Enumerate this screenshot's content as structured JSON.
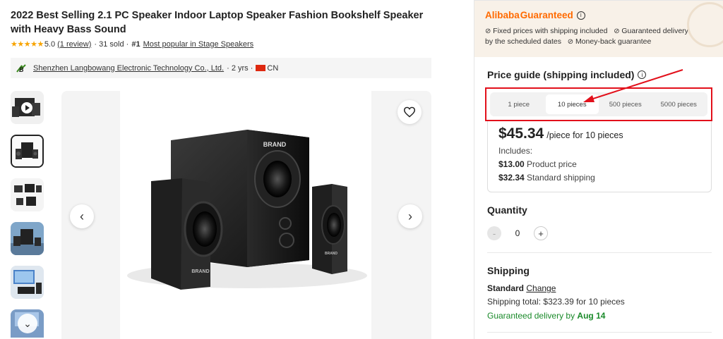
{
  "product": {
    "title": "2022 Best Selling 2.1 PC Speaker Indoor Laptop Speaker Fashion Bookshelf Speaker with Heavy Bass Sound",
    "stars": "★★★★★",
    "rating": "5.0",
    "reviews": "(1 review)",
    "sold": "· 31 sold ·",
    "rank": "#1",
    "rank_text": "Most popular in Stage Speakers"
  },
  "supplier": {
    "name": "Shenzhen Langbowang Electronic Technology Co., Ltd.",
    "years": "· 2 yrs ·",
    "country": "CN",
    "flag_color": "#de2910"
  },
  "gallery": {
    "thumbnails": [
      {
        "kind": "video",
        "icon": "play-icon"
      },
      {
        "kind": "image",
        "selected": true
      },
      {
        "kind": "image"
      },
      {
        "kind": "image"
      },
      {
        "kind": "image"
      },
      {
        "kind": "image",
        "icon": "chevron-down-icon"
      }
    ],
    "image_brand_text": "BRAND",
    "prev_icon": "‹",
    "next_icon": "›",
    "scroll_down_icon": "⌄"
  },
  "guarantee": {
    "brand": "Alibaba",
    "word": "Guaranteed",
    "info_icon": "i",
    "items": [
      "Fixed prices with shipping included",
      "Guaranteed delivery"
    ],
    "items_line2": [
      "by the scheduled dates",
      "Money-back guarantee"
    ]
  },
  "price_guide": {
    "title": "Price guide (shipping included)",
    "info_icon": "i",
    "tabs": [
      "1 piece",
      "10 pieces",
      "500 pieces",
      "5000 pieces"
    ],
    "active_tab": "10 pieces",
    "price": "$45.34",
    "price_unit": "/piece for 10 pieces",
    "includes_label": "Includes:",
    "product_price_value": "$13.00",
    "product_price_label": "Product price",
    "shipping_value": "$32.34",
    "shipping_label": "Standard shipping"
  },
  "quantity": {
    "title": "Quantity",
    "minus": "-",
    "value": "0",
    "plus": "+"
  },
  "shipping": {
    "title": "Shipping",
    "method": "Standard",
    "change": "Change",
    "total": "Shipping total: $323.39 for 10 pieces",
    "delivery_prefix": "Guaranteed delivery by",
    "delivery_date": "Aug 14",
    "delivery_color": "#1a8a2a"
  },
  "colors": {
    "accent": "#ff6a00",
    "highlight_box": "#e2101b",
    "star": "#f7a400"
  }
}
